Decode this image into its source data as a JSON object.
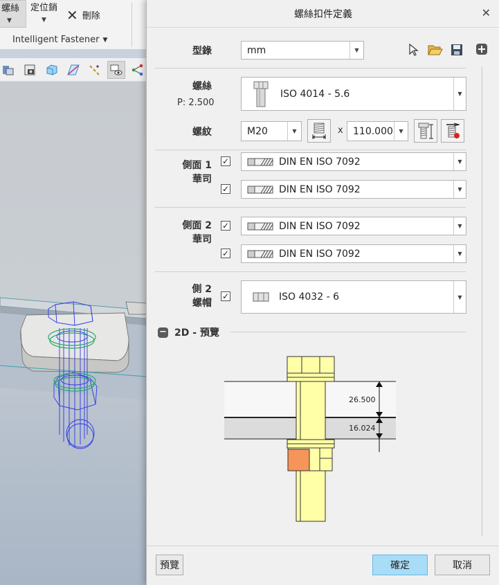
{
  "ribbon": {
    "screw_label": "螺絲",
    "pin_label": "定位銷",
    "delete_label": "刪除",
    "group_label": "Intelligent Fastener"
  },
  "toolbar": {
    "icons": [
      "axis-icon",
      "camera-icon",
      "cube-icon",
      "plane-icon",
      "points-icon",
      "layer-visibility-icon",
      "network-icon"
    ]
  },
  "dialog": {
    "title": "螺絲扣件定義",
    "catalog_label": "型錄",
    "catalog_value": "mm",
    "screw_label": "螺絲",
    "pitch_text": "P: 2.500",
    "screw_value": "ISO 4014 - 5.6",
    "thread_label": "螺紋",
    "thread_size": "M20",
    "times_sign": "x",
    "length_value": "110.000",
    "side1_label_line1": "側面 1",
    "side1_label_line2": "華司",
    "side1_washer1": "DIN EN ISO 7092",
    "side1_washer2": "DIN EN ISO 7092",
    "side2_label_line1": "側面 2",
    "side2_label_line2": "華司",
    "side2_washer1": "DIN EN ISO 7092",
    "side2_washer2": "DIN EN ISO 7092",
    "nut_label_line1": "側 2",
    "nut_label_line2": "螺帽",
    "nut_value": "ISO 4032 - 6",
    "preview_section_label": "2D - 預覽",
    "preview_dims": [
      "26.500",
      "16.024"
    ],
    "preview_button": "預覽",
    "ok_button": "確定",
    "cancel_button": "取消"
  },
  "colors": {
    "dialog_bg": "#f0f0f0",
    "primary_button": "#a9dcf6",
    "bolt_fill": "#ffffa8",
    "nut_fill": "#f5955a",
    "plate_top": "#f7f7f7",
    "plate_bottom": "#dcdcdc",
    "wireframe_blue": "#2a36e6",
    "wireframe_green": "#23a86b"
  }
}
